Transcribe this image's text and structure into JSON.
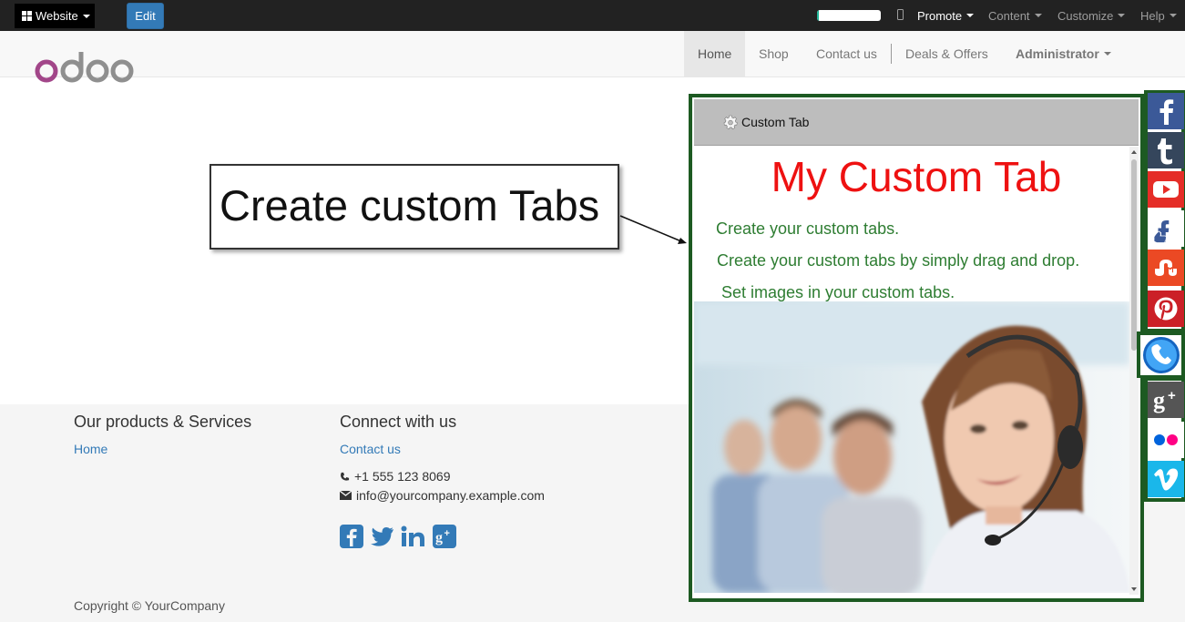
{
  "topbar": {
    "website_label": "Website",
    "edit_label": "Edit",
    "progress_percent": 3,
    "menus": [
      "Promote",
      "Content",
      "Customize",
      "Help"
    ]
  },
  "header": {
    "logo_text": "odoo",
    "nav": [
      "Home",
      "Shop",
      "Contact us",
      "Deals & Offers",
      "Administrator"
    ]
  },
  "callout": {
    "text": "Create custom Tabs"
  },
  "panel": {
    "tab_label": "Custom Tab",
    "title": "My Custom Tab",
    "lines": [
      "Create your custom tabs.",
      "Create your custom tabs by simply drag and drop.",
      "Set images in your custom tabs."
    ]
  },
  "footer": {
    "products_heading": "Our products & Services",
    "products_link": "Home",
    "connect_heading": "Connect with us",
    "contact_link": "Contact us",
    "phone": "+1 555 123 8069",
    "email": "info@yourcompany.example.com",
    "copyright": "Copyright © YourCompany"
  },
  "social_sidebar": {
    "icons": [
      "facebook-icon",
      "tumblr-icon",
      "youtube-icon",
      "facebook-thumb-icon",
      "stumbleupon-icon",
      "pinterest-icon",
      "phone-icon",
      "google-plus-icon",
      "flickr-icon",
      "vimeo-icon"
    ]
  },
  "colors": {
    "topbar": "#222222",
    "accent_blue": "#337ab7",
    "panel_border": "#1d5a22",
    "panel_title": "#ee1111",
    "panel_text": "#2e7d32"
  }
}
